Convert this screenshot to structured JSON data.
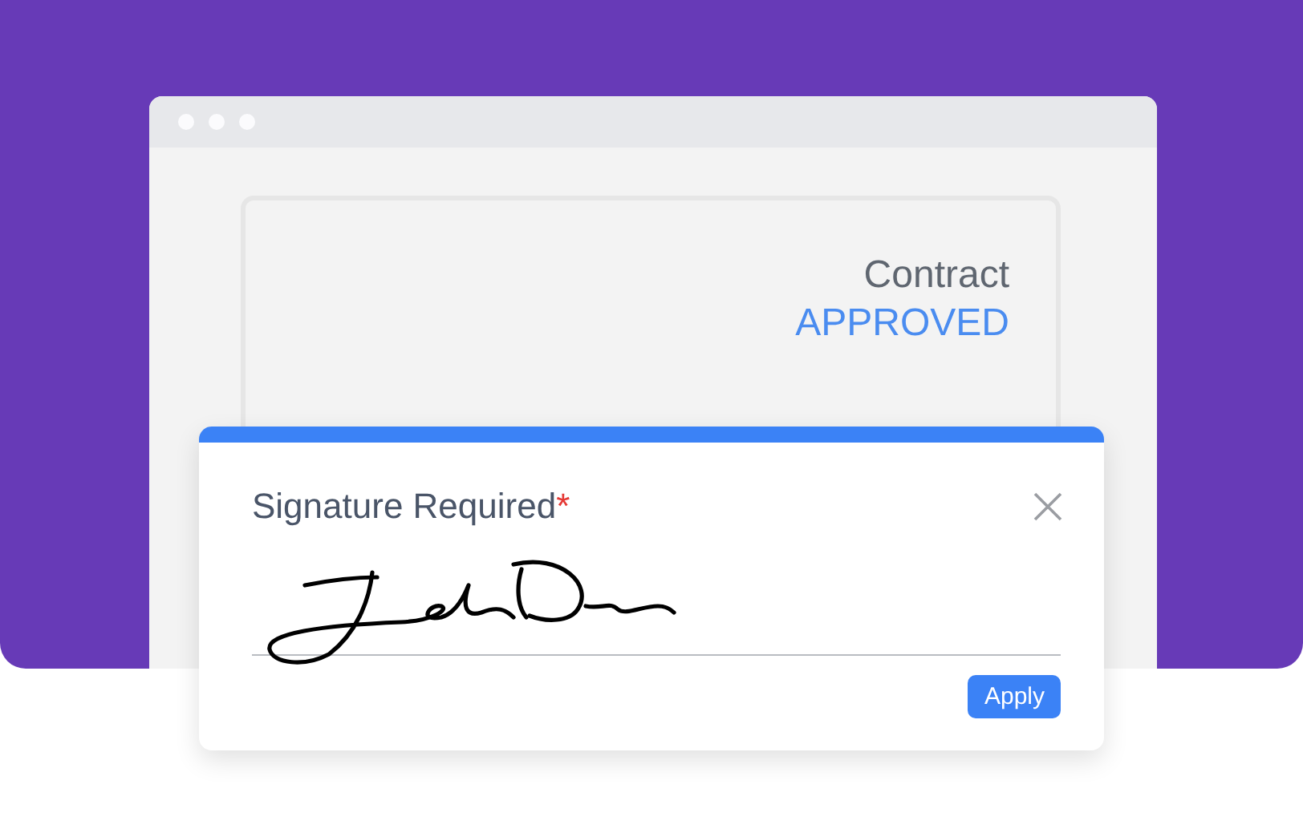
{
  "document": {
    "title": "Contract",
    "status": "APPROVED"
  },
  "dialog": {
    "title": "Signature Required",
    "required_mark": "*",
    "signature": {
      "signed": true
    },
    "button": "Apply"
  }
}
